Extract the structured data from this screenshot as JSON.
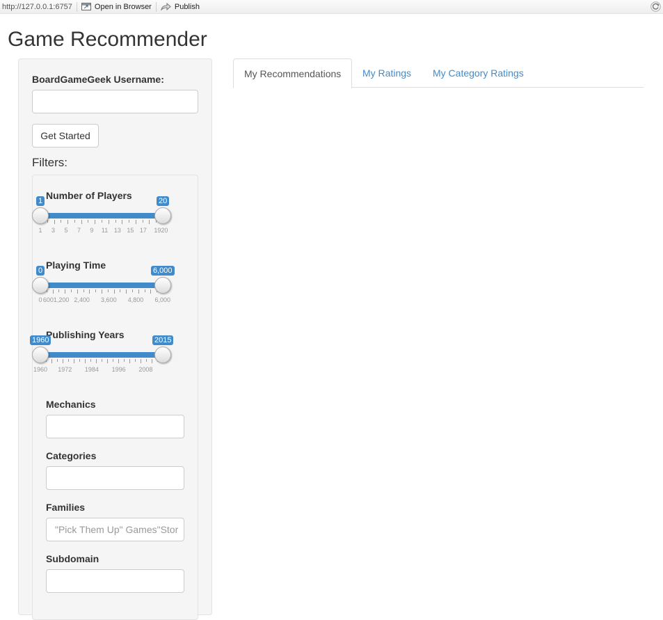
{
  "toolbar": {
    "url": "http://127.0.0.1:6757",
    "open_in_browser": "Open in Browser",
    "publish": "Publish"
  },
  "app_title": "Game Recommender",
  "sidebar": {
    "username_label": "BoardGameGeek Username:",
    "username_value": "",
    "get_started": "Get Started",
    "filters_title": "Filters:",
    "players": {
      "label": "Number of Players",
      "min": 1,
      "max": 20,
      "from": 1,
      "to": 20,
      "from_label": "1",
      "to_label": "20",
      "tick_labels": [
        "1",
        "3",
        "5",
        "7",
        "9",
        "11",
        "13",
        "15",
        "17",
        "1920"
      ]
    },
    "playing_time": {
      "label": "Playing Time",
      "min": 0,
      "max": 6000,
      "from": 0,
      "to": 6000,
      "from_label": "0",
      "to_label": "6,000",
      "tick_labels": [
        "0",
        "6001,200",
        "2,400",
        "3,600",
        "4,800",
        "6,000"
      ]
    },
    "years": {
      "label": "Publishing Years",
      "min": 1960,
      "max": 2015,
      "from": 1960,
      "to": 2015,
      "from_label": "1960",
      "to_label": "2015",
      "tick_labels": [
        "1960",
        "1972",
        "1984",
        "1996",
        "2008"
      ]
    },
    "mechanics": {
      "label": "Mechanics",
      "value": ""
    },
    "categories": {
      "label": "Categories",
      "value": ""
    },
    "families": {
      "label": "Families",
      "placeholder": "\"Pick Them Up\" Games\"Stor"
    },
    "subdomain": {
      "label": "Subdomain",
      "value": ""
    }
  },
  "tabs": [
    {
      "label": "My Recommendations",
      "active": true
    },
    {
      "label": "My Ratings",
      "active": false
    },
    {
      "label": "My Category Ratings",
      "active": false
    }
  ],
  "colors": {
    "accent": "#428bca",
    "link": "#428bca"
  }
}
